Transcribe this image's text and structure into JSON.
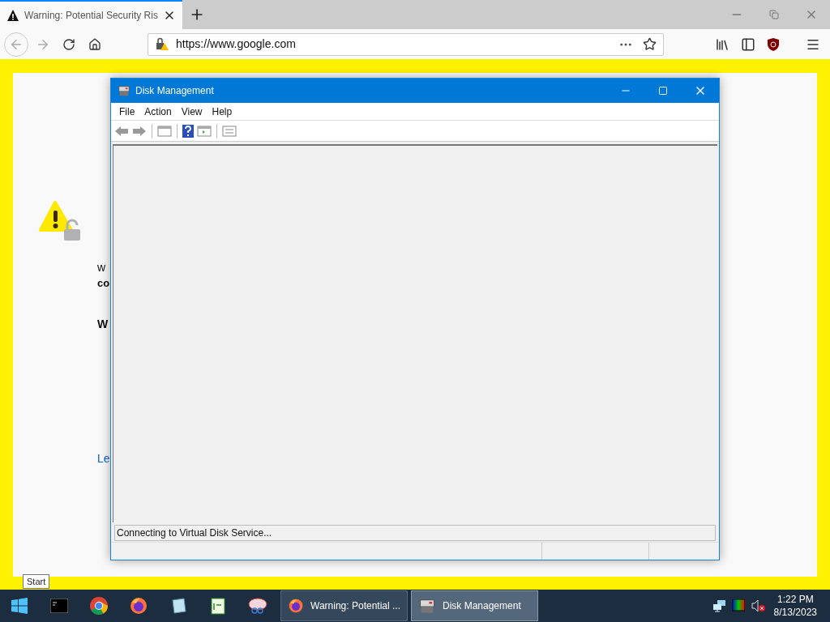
{
  "browser": {
    "tabs": [
      {
        "title": "Warning: Potential Security Ris",
        "selected": true
      }
    ],
    "url": "https://www.google.com"
  },
  "page": {
    "line_1": "w",
    "line_2": "co",
    "line_3": "W",
    "link": "Le"
  },
  "dialog": {
    "title": "Disk Management",
    "menu": [
      "File",
      "Action",
      "View",
      "Help"
    ],
    "status": "Connecting to Virtual Disk Service..."
  },
  "tooltip": "Start",
  "taskbar": {
    "windows": [
      {
        "label": "Warning: Potential ...",
        "kind": "firefox",
        "selected": false
      },
      {
        "label": "Disk Management",
        "kind": "disk",
        "selected": true
      }
    ],
    "time": "1:22 PM",
    "date": "8/13/2023"
  }
}
